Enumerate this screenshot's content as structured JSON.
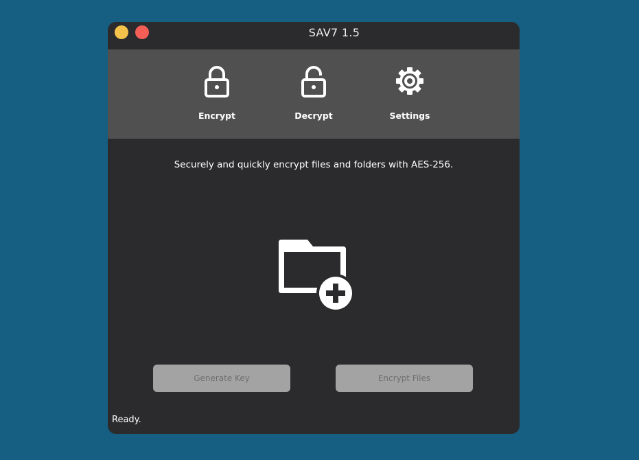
{
  "window": {
    "title": "SAV7 1.5"
  },
  "toolbar": {
    "items": [
      {
        "label": "Encrypt",
        "icon": "lock-closed-icon"
      },
      {
        "label": "Decrypt",
        "icon": "lock-open-icon"
      },
      {
        "label": "Settings",
        "icon": "gear-icon"
      }
    ]
  },
  "main": {
    "description": "Securely and quickly encrypt files and folders with AES-256.",
    "dropzone_icon": "folder-add-icon"
  },
  "buttons": {
    "generate_key": "Generate Key",
    "encrypt_files": "Encrypt Files"
  },
  "status": "Ready.",
  "colors": {
    "background": "#165f82",
    "window": "#2b2b2d",
    "toolbar": "#505050",
    "minimize": "#f5c24c",
    "close": "#f45e57",
    "button_disabled": "#a3a3a3"
  }
}
